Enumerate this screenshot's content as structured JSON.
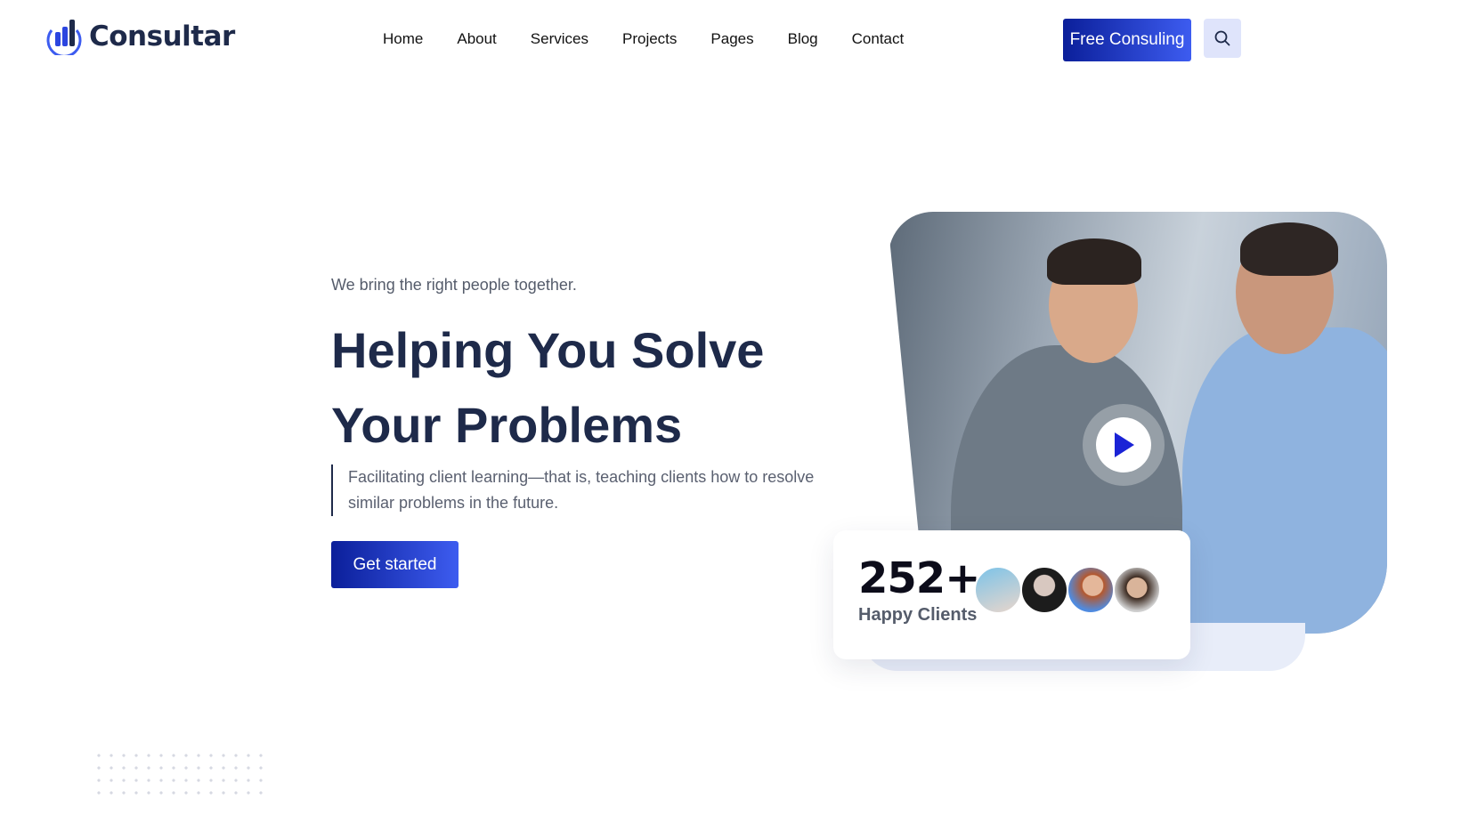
{
  "header": {
    "brand": "Consultar",
    "nav": [
      "Home",
      "About",
      "Services",
      "Projects",
      "Pages",
      "Blog",
      "Contact"
    ],
    "cta_label": "Free Consuling",
    "search_icon": "search-icon"
  },
  "hero": {
    "kicker": "We bring the right people together.",
    "title_line1": "Helping You Solve",
    "title_line2": "Your Problems",
    "description": "Facilitating client learning—that is, teaching clients how to resolve similar problems in the future.",
    "button_label": "Get started"
  },
  "stats": {
    "count": "252+",
    "label": "Happy Clients"
  },
  "colors": {
    "brand_dark": "#1e2a4a",
    "accent_start": "#0b1f9a",
    "accent_end": "#3d5cf0",
    "search_bg": "#dfe4fb"
  }
}
